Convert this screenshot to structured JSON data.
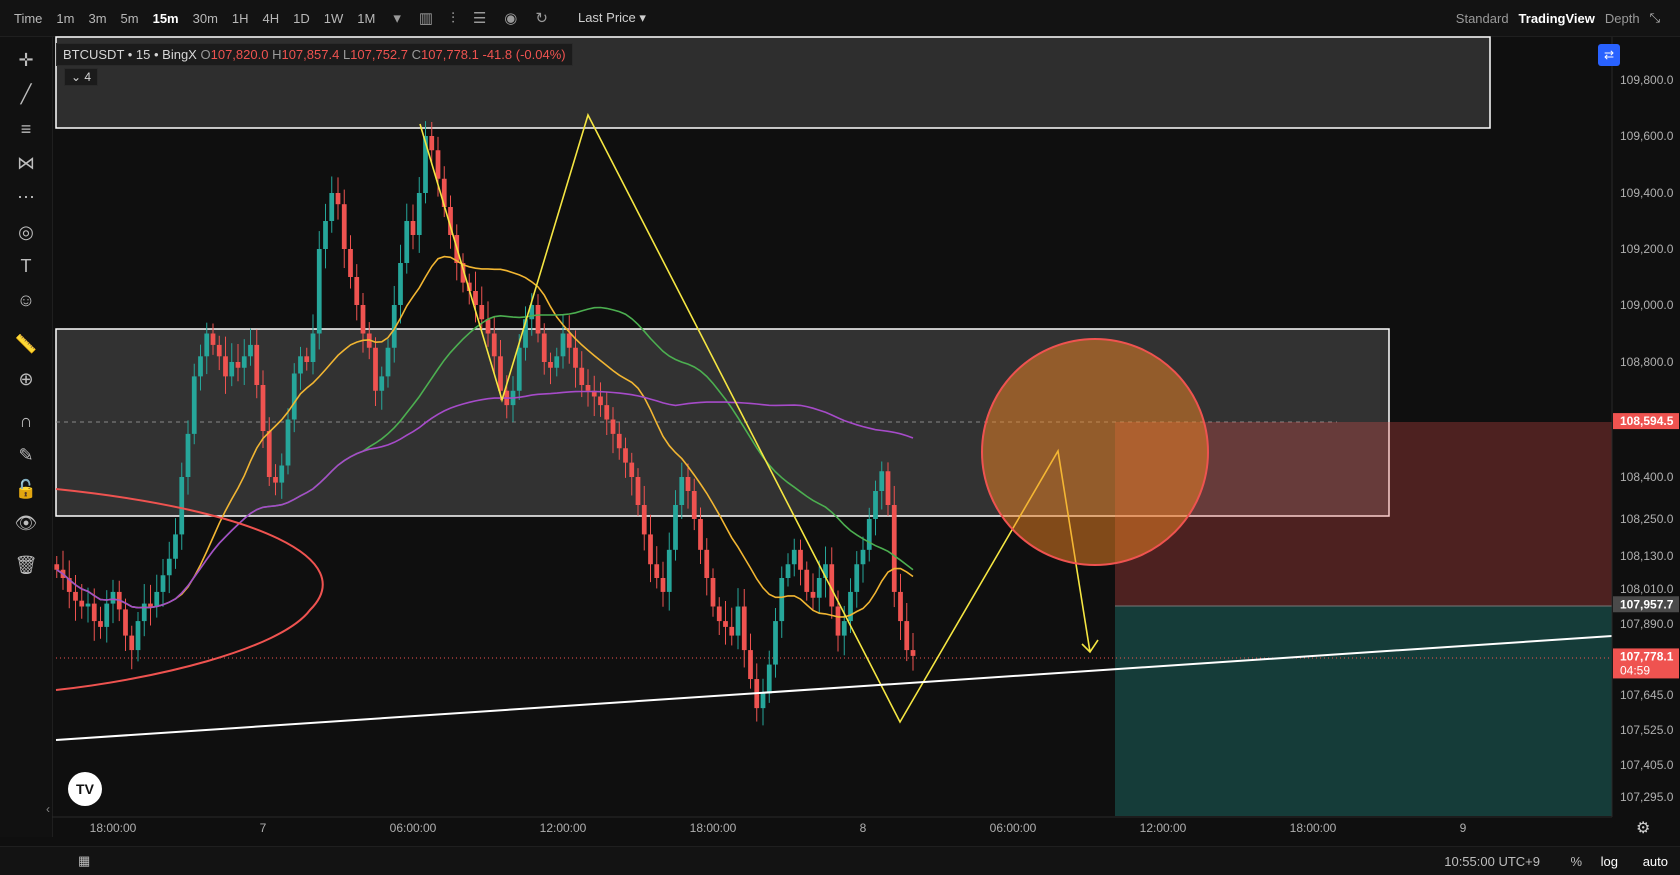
{
  "toolbar": {
    "timeframes": [
      "Time",
      "1m",
      "3m",
      "5m",
      "15m",
      "30m",
      "1H",
      "4H",
      "1D",
      "1W",
      "1M"
    ],
    "active": "15m",
    "price_mode": "Last Price",
    "views": {
      "standard": "Standard",
      "tradingview": "TradingView",
      "depth": "Depth"
    }
  },
  "legend": {
    "symbol": "BTCUSDT • 15 • BingX",
    "o_label": "O",
    "o": "107,820.0",
    "h_label": "H",
    "h": "107,857.4",
    "l_label": "L",
    "l": "107,752.7",
    "c_label": "C",
    "c": "107,778.1",
    "change": "-41.8 (-0.04%)",
    "indicators_count": "4"
  },
  "bottom": {
    "time": "10:55:00 UTC+9",
    "pct": "%",
    "log": "log",
    "auto": "auto"
  },
  "colors": {
    "up": "#26a69a",
    "down": "#ef5350",
    "bg": "#0f0f0f",
    "yellow": "#f5e642",
    "orange": "#f2b632",
    "green": "#4caf50",
    "purple": "#a64bc9"
  },
  "chart_data": {
    "type": "candlestick",
    "symbol": "BTCUSDT",
    "interval": "15",
    "exchange": "BingX",
    "y_ticks": [
      "109,800.0",
      "109,600.0",
      "109,400.0",
      "109,200.0",
      "109,000.0",
      "108,800.0",
      "108,400.0",
      "108,250.0",
      "108,130.0",
      "108,010.0",
      "107,890.0",
      "107,645.0",
      "107,525.0",
      "107,405.0",
      "107,295.0"
    ],
    "y_tick_values": [
      109800,
      109600,
      109400,
      109200,
      109000,
      108800,
      108400,
      108250,
      108130,
      108010,
      107890,
      107645,
      107525,
      107405,
      107295
    ],
    "x_ticks": [
      "18:00:00",
      "7",
      "06:00:00",
      "12:00:00",
      "18:00:00",
      "8",
      "06:00:00",
      "12:00:00",
      "18:00:00",
      "9"
    ],
    "x_tick_times": [
      18,
      24,
      30,
      36,
      42,
      48,
      54,
      60,
      66,
      72
    ],
    "price_labels": [
      {
        "text": "108,594.5",
        "value": 108594.5,
        "bg": "#ef5350"
      },
      {
        "text": "107,957.7",
        "value": 107957.7,
        "bg": "#4a4a4a"
      },
      {
        "text": "107,778.1",
        "value": 107778.1,
        "bg": "#ef5350",
        "countdown": "04:59"
      }
    ],
    "candle_start_time": 15.75,
    "candle_interval_hours": 0.25,
    "closes": [
      108080,
      108050,
      108000,
      107970,
      107950,
      107960,
      107900,
      107880,
      107960,
      108000,
      107940,
      107850,
      107800,
      107900,
      107960,
      107950,
      108000,
      108060,
      108120,
      108200,
      108400,
      108550,
      108750,
      108820,
      108900,
      108860,
      108820,
      108750,
      108800,
      108780,
      108820,
      108860,
      108720,
      108560,
      108400,
      108380,
      108440,
      108600,
      108760,
      108820,
      108800,
      108900,
      109200,
      109300,
      109400,
      109360,
      109200,
      109100,
      109000,
      108900,
      108850,
      108700,
      108750,
      108850,
      109000,
      109150,
      109300,
      109250,
      109400,
      109600,
      109550,
      109450,
      109350,
      109250,
      109150,
      109080,
      109050,
      109000,
      108950,
      108900,
      108820,
      108700,
      108650,
      108700,
      108850,
      108950,
      109000,
      108900,
      108800,
      108780,
      108820,
      108900,
      108850,
      108780,
      108720,
      108700,
      108680,
      108650,
      108600,
      108550,
      108500,
      108450,
      108400,
      108300,
      108200,
      108100,
      108050,
      108000,
      108150,
      108300,
      108400,
      108350,
      108250,
      108150,
      108050,
      107950,
      107900,
      107880,
      107850,
      107950,
      107800,
      107700,
      107600,
      107650,
      107750,
      107900,
      108050,
      108100,
      108150,
      108080,
      108000,
      107980,
      108050,
      108100,
      107950,
      107850,
      107900,
      108000,
      108100,
      108150,
      108250,
      108350,
      108420,
      108300,
      108000,
      107900,
      107800,
      107780
    ]
  }
}
